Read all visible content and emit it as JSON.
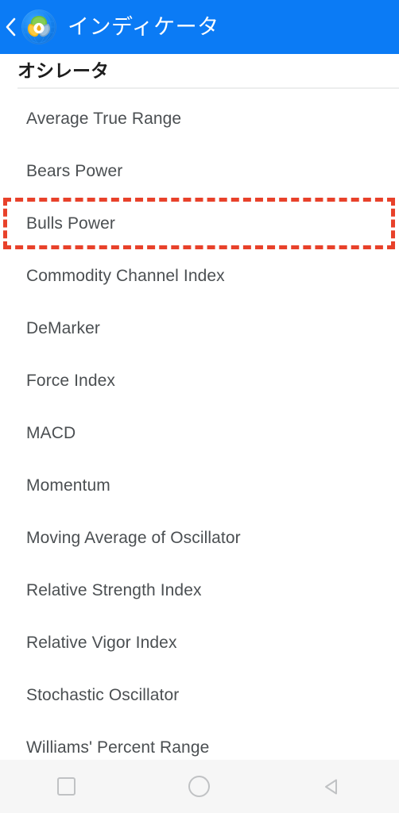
{
  "appbar": {
    "back_label": "‹",
    "back_icon": "chevron-left-icon",
    "app_icon": "metatrader-app-icon",
    "title": "インディケータ",
    "background_color": "#0b7bf5",
    "title_color": "#ffffff"
  },
  "section": {
    "title": "オシレータ",
    "divider_color": "#eceded"
  },
  "list": {
    "items": [
      {
        "label": "Average True Range"
      },
      {
        "label": "Bears Power"
      },
      {
        "label": "Bulls Power"
      },
      {
        "label": "Commodity Channel Index"
      },
      {
        "label": "DeMarker"
      },
      {
        "label": "Force Index"
      },
      {
        "label": "MACD"
      },
      {
        "label": "Momentum"
      },
      {
        "label": "Moving Average of Oscillator"
      },
      {
        "label": "Relative Strength Index"
      },
      {
        "label": "Relative Vigor Index"
      },
      {
        "label": "Stochastic Oscillator"
      },
      {
        "label": "Williams' Percent Range"
      }
    ],
    "text_color": "#4b4f52"
  },
  "highlight": {
    "target_label": "Bulls Power",
    "color": "#e8412a",
    "style": "dashed"
  },
  "navbar": {
    "background_color": "#f6f6f6",
    "icon_color": "#c0c2c4",
    "buttons": [
      {
        "name": "recents",
        "icon": "square-icon"
      },
      {
        "name": "home",
        "icon": "circle-icon"
      },
      {
        "name": "back",
        "icon": "triangle-left-icon"
      }
    ]
  }
}
